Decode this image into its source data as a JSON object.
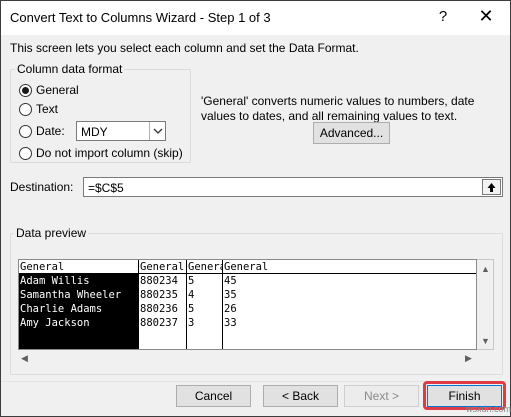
{
  "window": {
    "title": "Convert Text to Columns Wizard - Step 1 of 3",
    "help": "?",
    "close": "✕"
  },
  "intro": "This screen lets you select each column and set the Data Format.",
  "column_format": {
    "legend": "Column data format",
    "options": [
      {
        "label": "General",
        "checked": true
      },
      {
        "label": "Text",
        "checked": false
      },
      {
        "label": "Date:",
        "checked": false
      },
      {
        "label": "Do not import column (skip)",
        "checked": false
      }
    ],
    "date_combo_value": "MDY",
    "description": "'General' converts numeric values to numbers, date values to dates, and all remaining values to text.",
    "advanced_label": "Advanced..."
  },
  "destination": {
    "label": "Destination:",
    "value": "=$C$5"
  },
  "preview": {
    "legend": "Data preview",
    "columns": [
      {
        "header": "General",
        "cells": [
          "Adam Willis",
          "Samantha Wheeler",
          "Charlie Adams",
          "Amy Jackson"
        ]
      },
      {
        "header": "General",
        "cells": [
          "880234",
          "880235",
          "880236",
          "880237"
        ]
      },
      {
        "header": "General",
        "cells": [
          "5",
          "4",
          "5",
          "3"
        ]
      },
      {
        "header": "General",
        "cells": [
          "45",
          "35",
          "26",
          "33"
        ]
      }
    ]
  },
  "buttons": {
    "cancel": "Cancel",
    "back": "< Back",
    "next": "Next >",
    "finish": "Finish"
  },
  "watermark": "wsxdn.com"
}
